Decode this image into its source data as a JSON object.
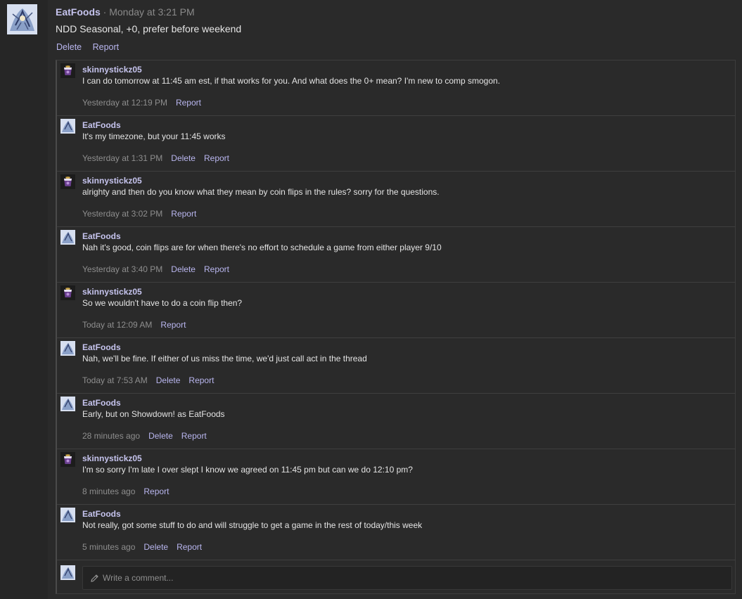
{
  "post": {
    "author": "EatFoods",
    "separator": "·",
    "timestamp": "Monday at 3:21 PM",
    "body": "NDD Seasonal, +0, prefer before weekend",
    "actions": {
      "delete": "Delete",
      "report": "Report"
    }
  },
  "comments": [
    {
      "author": "skinnystickz05",
      "text": "I can do tomorrow at 11:45 am est, if that works for you. And what does the 0+ mean? I'm new to comp smogon.",
      "time": "Yesterday at 12:19 PM",
      "delete": "",
      "report": "Report",
      "avatar_icon": "cup-avatar"
    },
    {
      "author": "EatFoods",
      "text": "It's my timezone, but your 11:45 works",
      "time": "Yesterday at 1:31 PM",
      "delete": "Delete",
      "report": "Report",
      "avatar_icon": "sketch-avatar"
    },
    {
      "author": "skinnystickz05",
      "text": "alrighty and then do you know what they mean by coin flips in the rules? sorry for the questions.",
      "time": "Yesterday at 3:02 PM",
      "delete": "",
      "report": "Report",
      "avatar_icon": "cup-avatar"
    },
    {
      "author": "EatFoods",
      "text": "Nah it's good, coin flips are for when there's no effort to schedule a game from either player 9/10",
      "time": "Yesterday at 3:40 PM",
      "delete": "Delete",
      "report": "Report",
      "avatar_icon": "sketch-avatar"
    },
    {
      "author": "skinnystickz05",
      "text": "So we wouldn't have to do a coin flip then?",
      "time": "Today at 12:09 AM",
      "delete": "",
      "report": "Report",
      "avatar_icon": "cup-avatar"
    },
    {
      "author": "EatFoods",
      "text": "Nah, we'll be fine. If either of us miss the time, we'd just call act in the thread",
      "time": "Today at 7:53 AM",
      "delete": "Delete",
      "report": "Report",
      "avatar_icon": "sketch-avatar"
    },
    {
      "author": "EatFoods",
      "text": "Early, but on Showdown! as EatFoods",
      "time": "28 minutes ago",
      "delete": "Delete",
      "report": "Report",
      "avatar_icon": "sketch-avatar"
    },
    {
      "author": "skinnystickz05",
      "text": "I'm so sorry I'm late I over slept I know we agreed on 11:45 pm but can we do 12:10 pm?",
      "time": "8 minutes ago",
      "delete": "",
      "report": "Report",
      "avatar_icon": "cup-avatar"
    },
    {
      "author": "EatFoods",
      "text": "Not really, got some stuff to do and will struggle to get a game in the rest of today/this week",
      "time": "5 minutes ago",
      "delete": "Delete",
      "report": "Report",
      "avatar_icon": "sketch-avatar"
    }
  ],
  "composer": {
    "placeholder": "Write a comment...",
    "icon": "pencil-icon"
  },
  "colors": {
    "background": "#2a2a2a",
    "username": "#c6c4ee",
    "link": "#b9b6ef",
    "muted": "#8e8e8e",
    "text": "#e4e4e4"
  }
}
